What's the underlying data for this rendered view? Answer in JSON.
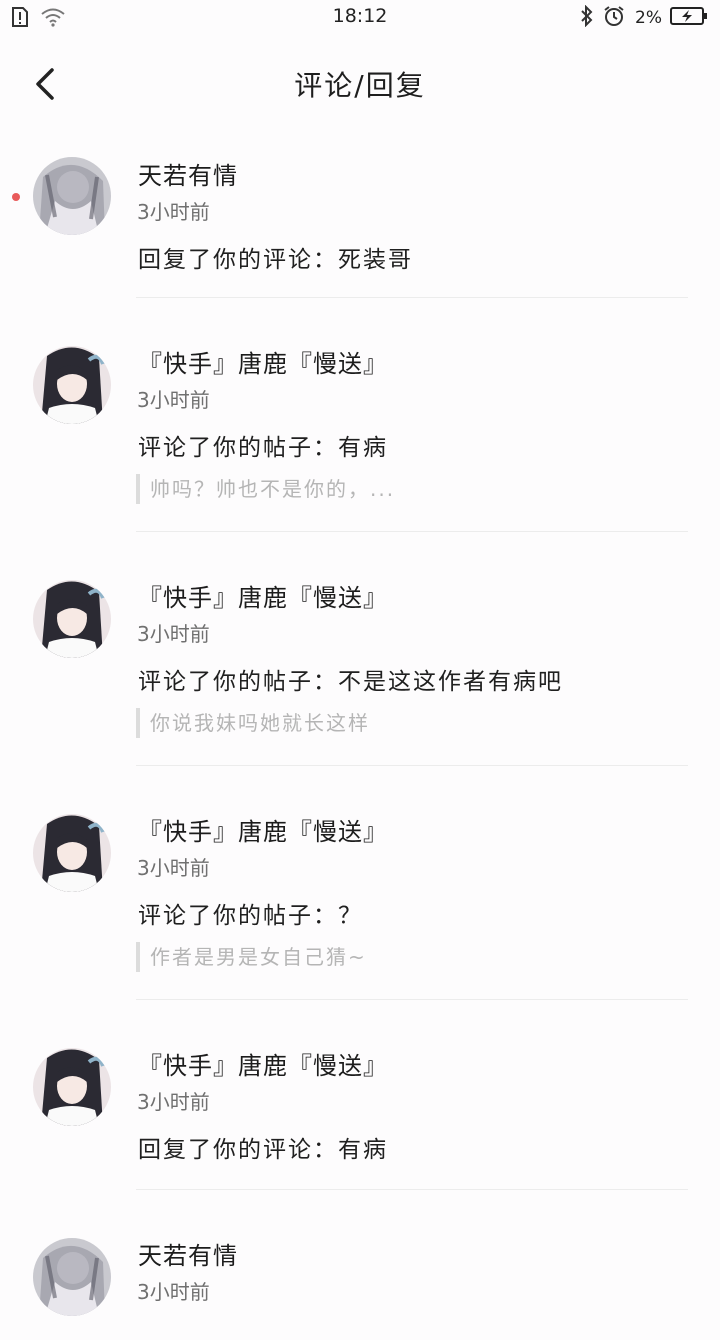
{
  "status_bar": {
    "time": "18:12",
    "battery_percent": "2%"
  },
  "header": {
    "title": "评论/回复"
  },
  "items": [
    {
      "name": "天若有情",
      "time": "3小时前",
      "message": "回复了你的评论：死装哥",
      "quote": null,
      "avatar": "avatar-gray",
      "unread": true
    },
    {
      "name": "『快手』唐鹿『慢送』",
      "time": "3小时前",
      "message": "评论了你的帖子：有病",
      "quote": "帅吗？帅也不是你的，...",
      "avatar": "avatar-girl",
      "unread": false
    },
    {
      "name": "『快手』唐鹿『慢送』",
      "time": "3小时前",
      "message": "评论了你的帖子：不是这这作者有病吧",
      "quote": "你说我妹吗她就长这样",
      "avatar": "avatar-girl",
      "unread": false
    },
    {
      "name": "『快手』唐鹿『慢送』",
      "time": "3小时前",
      "message": "评论了你的帖子：？",
      "quote": "作者是男是女自己猜~",
      "avatar": "avatar-girl",
      "unread": false
    },
    {
      "name": "『快手』唐鹿『慢送』",
      "time": "3小时前",
      "message": "回复了你的评论：有病",
      "quote": null,
      "avatar": "avatar-girl",
      "unread": false
    },
    {
      "name": "天若有情",
      "time": "3小时前",
      "message": "",
      "quote": null,
      "avatar": "avatar-gray",
      "unread": false
    }
  ]
}
